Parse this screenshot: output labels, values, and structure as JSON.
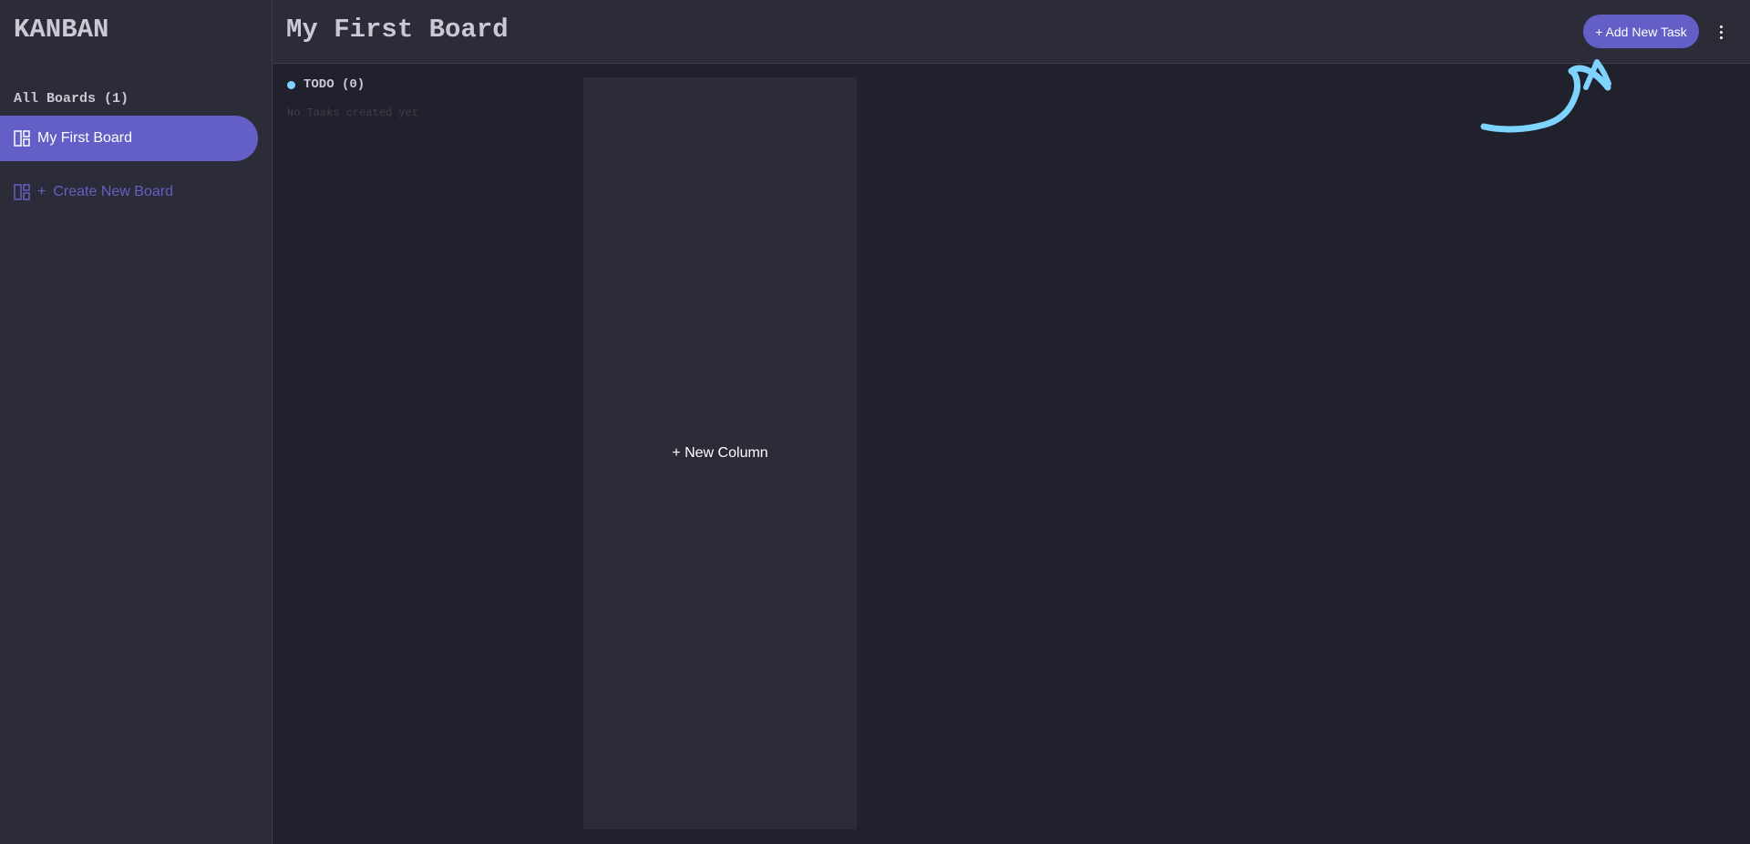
{
  "app": {
    "logo": "KANBAN"
  },
  "sidebar": {
    "heading": "All Boards (1)",
    "boards": [
      {
        "label": "My First Board",
        "active": true
      }
    ],
    "create_plus": "+",
    "create_label": "Create New Board"
  },
  "header": {
    "title": "My First Board",
    "add_task_label": "+ Add New Task",
    "menu_icon": "vertical-ellipsis-icon"
  },
  "columns": [
    {
      "title": "TODO (0)",
      "dot_color": "#7ed3ff",
      "empty_text": "No Tasks created yet"
    }
  ],
  "new_column_label": "+ New Column",
  "colors": {
    "accent": "#635fc7",
    "sidebar_bg": "#2b2c37",
    "main_bg": "#21212d",
    "annotation": "#7ed3ff"
  }
}
